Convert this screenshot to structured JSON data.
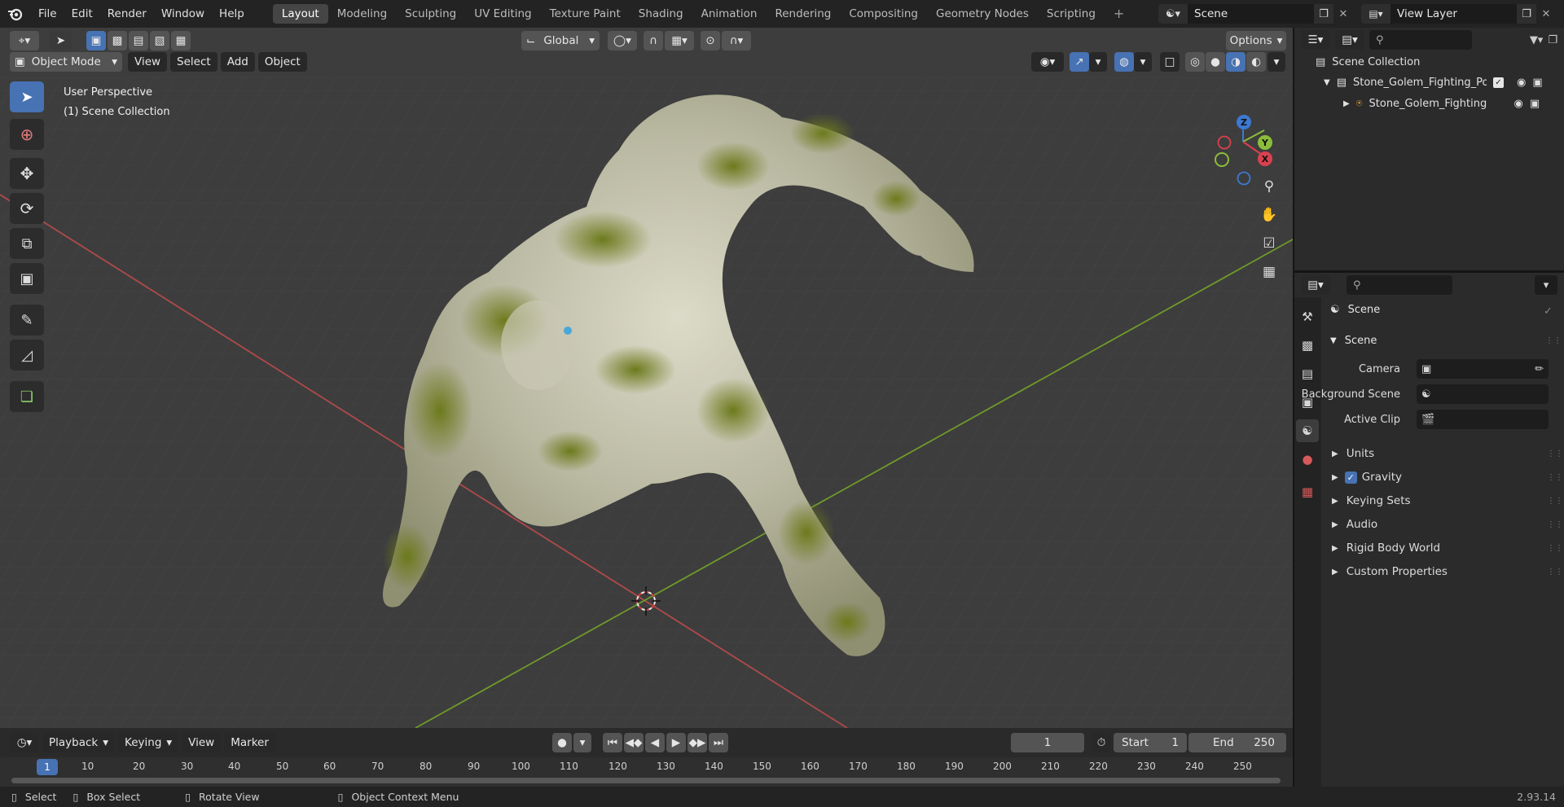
{
  "app": {
    "version": "2.93.14"
  },
  "menubar": {
    "items": [
      "File",
      "Edit",
      "Render",
      "Window",
      "Help"
    ]
  },
  "workspaces": {
    "tabs": [
      "Layout",
      "Modeling",
      "Sculpting",
      "UV Editing",
      "Texture Paint",
      "Shading",
      "Animation",
      "Rendering",
      "Compositing",
      "Geometry Nodes",
      "Scripting"
    ],
    "active": "Layout",
    "add_label": "+"
  },
  "scene_selector": {
    "value": "Scene"
  },
  "viewlayer_selector": {
    "value": "View Layer"
  },
  "viewport": {
    "transform_orientation": "Global",
    "options_label": "Options",
    "mode": "Object Mode",
    "menus": [
      "View",
      "Select",
      "Add",
      "Object"
    ],
    "perspective_label": "User Perspective",
    "collection_label": "(1) Scene Collection",
    "gizmo_axes": {
      "x": "X",
      "y": "Y",
      "z": "Z"
    },
    "colors": {
      "x_axis": "#c94a4a",
      "y_axis": "#7aa52a",
      "background": "#3d3d3d",
      "active_tool": "#4772b3"
    }
  },
  "toolbar": {
    "tools": [
      "select-box-icon",
      "cursor-icon",
      "move-icon",
      "rotate-icon",
      "scale-icon",
      "transform-icon",
      "annotate-icon",
      "measure-icon",
      "add-cube-icon"
    ]
  },
  "outliner": {
    "root": "Scene Collection",
    "items": [
      {
        "label": "Stone_Golem_Fighting_Pose_",
        "icon": "collection-icon"
      },
      {
        "label": "Stone_Golem_Fighting_P",
        "icon": "armature-icon"
      }
    ]
  },
  "properties": {
    "context_label": "Scene",
    "section_title": "Scene",
    "fields": [
      {
        "label": "Camera"
      },
      {
        "label": "Background Scene"
      },
      {
        "label": "Active Clip"
      }
    ],
    "collapsed_panels": [
      "Units",
      "Gravity",
      "Keying Sets",
      "Audio",
      "Rigid Body World",
      "Custom Properties"
    ],
    "gravity_checked": true
  },
  "timeline": {
    "menus": [
      "Playback",
      "Keying",
      "View",
      "Marker"
    ],
    "current_frame": "1",
    "start_label": "Start",
    "start_value": "1",
    "end_label": "End",
    "end_value": "250",
    "ruler": [
      "1",
      "10",
      "20",
      "30",
      "40",
      "50",
      "60",
      "70",
      "80",
      "90",
      "100",
      "110",
      "120",
      "130",
      "140",
      "150",
      "160",
      "170",
      "180",
      "190",
      "200",
      "210",
      "220",
      "230",
      "240",
      "250"
    ]
  },
  "statusbar": {
    "items": [
      "Select",
      "Box Select",
      "Rotate View",
      "Object Context Menu"
    ]
  }
}
